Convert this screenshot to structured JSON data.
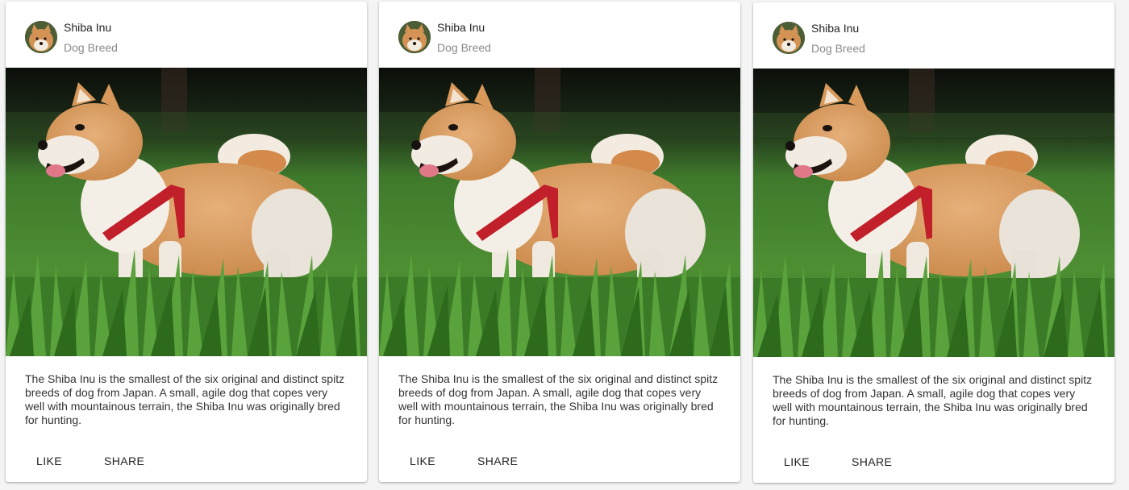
{
  "colors": {
    "page_background": "#f4f4f4",
    "card_background": "#ffffff",
    "title": "#222222",
    "subtitle": "#8a8a8a",
    "body_text": "#333333"
  },
  "cards": [
    {
      "title": "Shiba Inu",
      "subtitle": "Dog Breed",
      "avatar_icon": "shiba-inu-avatar",
      "image": "shiba-inu-photo",
      "description": "The Shiba Inu is the smallest of the six original and distinct spitz breeds of dog from Japan. A small, agile dog that copes very well with mountainous terrain, the Shiba Inu was originally bred for hunting.",
      "actions": {
        "like": "LIKE",
        "share": "SHARE"
      }
    },
    {
      "title": "Shiba Inu",
      "subtitle": "Dog Breed",
      "avatar_icon": "shiba-inu-avatar",
      "image": "shiba-inu-photo",
      "description": "The Shiba Inu is the smallest of the six original and distinct spitz breeds of dog from Japan. A small, agile dog that copes very well with mountainous terrain, the Shiba Inu was originally bred for hunting.",
      "actions": {
        "like": "LIKE",
        "share": "SHARE"
      }
    },
    {
      "title": "Shiba Inu",
      "subtitle": "Dog Breed",
      "avatar_icon": "shiba-inu-avatar",
      "image": "shiba-inu-photo",
      "description": "The Shiba Inu is the smallest of the six original and distinct spitz breeds of dog from Japan. A small, agile dog that copes very well with mountainous terrain, the Shiba Inu was originally bred for hunting.",
      "actions": {
        "like": "LIKE",
        "share": "SHARE"
      }
    }
  ]
}
